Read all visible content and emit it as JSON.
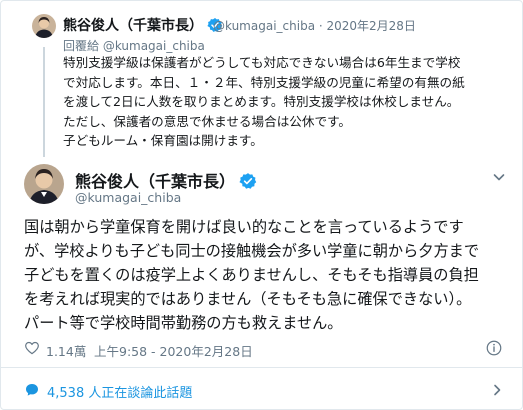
{
  "parent_tweet": {
    "name": "熊谷俊人（千葉市長）",
    "handle_time": "@kumagai_chiba · 2020年2月28日",
    "replying_to": "回覆給 @kumagai_chiba",
    "lines": [
      "特別支援学級は保護者がどうしても対応できない場合は6年生まで学校",
      "で対応します。本日、１・２年、特別支援学級の児童に希望の有無の紙",
      "を渡して2日に人数を取りまとめます。特別支援学校は休校しません。",
      "ただし、保護者の意思で休ませる場合は公休です。",
      "子どもルーム・保育園は開けます。"
    ]
  },
  "main_tweet": {
    "name": "熊谷俊人（千葉市長）",
    "handle": "@kumagai_chiba",
    "lines": [
      "国は朝から学童保育を開けば良い的なことを言っているようです",
      "が、学校よりも子ども同士の接触機会が多い学童に朝から夕方まで",
      "子どもを置くのは疫学上よくありませんし、そもそも指導員の負担",
      "を考えれば現実的ではありません（そもそも急に確保できない）。",
      "パート等で学校時間帯勤務の方も救えません。"
    ],
    "likes": "1.14萬",
    "timestamp": "上午9:58 - 2020年2月28日"
  },
  "conversation": {
    "label": "4,538 人正在談論此話題"
  },
  "colors": {
    "accent": "#1b95e0",
    "verified": "#1da1f2",
    "muted": "#657786",
    "border": "#e1e8ed"
  },
  "icons": [
    "verified-badge-icon",
    "chevron-down-icon",
    "heart-icon",
    "info-icon",
    "speech-bubble-icon",
    "chevron-right-icon"
  ]
}
